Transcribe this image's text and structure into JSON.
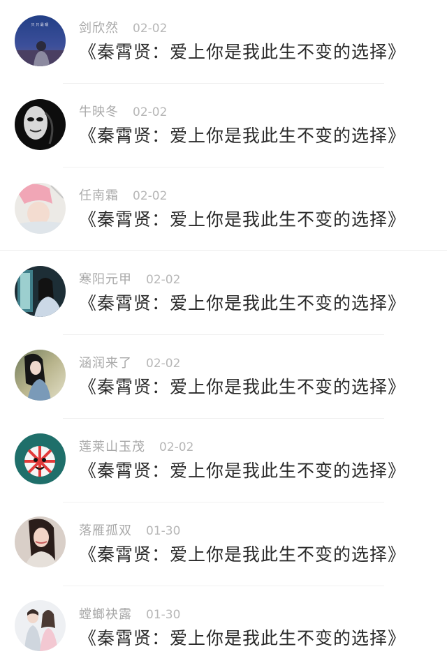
{
  "comments": [
    {
      "user": "剑欣然",
      "date": "02-02",
      "text": "《秦霄贤：爱上你是我此生不变的选择》",
      "avatar": "night-scene-avatar"
    },
    {
      "user": "牛映冬",
      "date": "02-02",
      "text": "《秦霄贤：爱上你是我此生不变的选择》",
      "avatar": "mask-face-avatar"
    },
    {
      "user": "任南霜",
      "date": "02-02",
      "text": "《秦霄贤：爱上你是我此生不变的选择》",
      "avatar": "pink-hair-avatar"
    },
    {
      "user": "寒阳元甲",
      "date": "02-02",
      "text": "《秦霄贤：爱上你是我此生不变的选择》",
      "avatar": "girl-in-window-avatar"
    },
    {
      "user": "涵润来了",
      "date": "02-02",
      "text": "《秦霄贤：爱上你是我此生不变的选择》",
      "avatar": "girl-portrait-avatar"
    },
    {
      "user": "莲莱山玉茂",
      "date": "02-02",
      "text": "《秦霄贤：爱上你是我此生不变的选择》",
      "avatar": "cartoon-character-avatar"
    },
    {
      "user": "落雁孤双",
      "date": "01-30",
      "text": "《秦霄贤：爱上你是我此生不变的选择》",
      "avatar": "woman-portrait-avatar"
    },
    {
      "user": "螳螂袂露",
      "date": "01-30",
      "text": "《秦霄贤：爱上你是我此生不变的选择》",
      "avatar": "couple-avatar"
    }
  ],
  "avatar_caption": "只 只 最 暖",
  "colors": {
    "username": "#a9a9a9",
    "date": "#b7b7b7",
    "message": "#2a2a2a",
    "divider": "#f0f0f0"
  }
}
